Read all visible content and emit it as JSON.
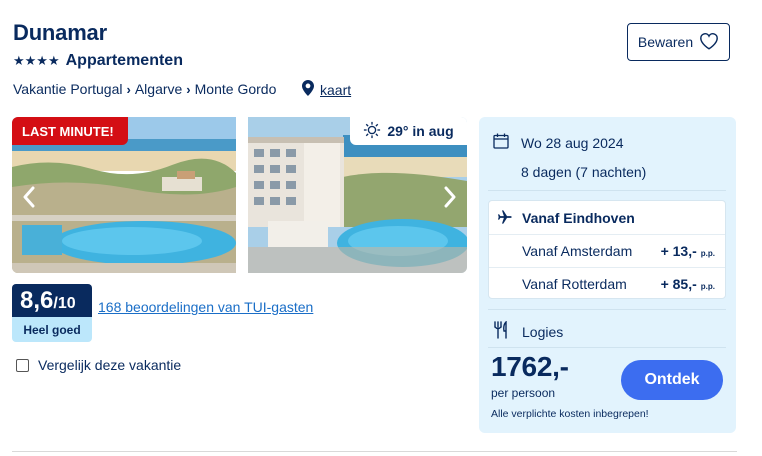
{
  "hotel": {
    "name": "Dunamar",
    "stars": "★★★★",
    "type": "Appartementen"
  },
  "breadcrumb": [
    "Vakantie Portugal",
    "Algarve",
    "Monte Gordo"
  ],
  "map_link": "kaart",
  "save_button": "Bewaren",
  "badge": "LAST MINUTE!",
  "weather": "29° in aug",
  "rating": {
    "score": "8,6",
    "max": "/10",
    "label": "Heel goed",
    "reviews": "168 beoordelingen van TUI-gasten"
  },
  "compare_label": "Vergelijk deze vakantie",
  "booking": {
    "date": "Wo 28 aug 2024",
    "duration": "8 dagen (7 nachten)",
    "departure_selected": "Vanaf Eindhoven",
    "alternatives": [
      {
        "name": "Vanaf Amsterdam",
        "price": "+ 13,-",
        "unit": "p.p."
      },
      {
        "name": "Vanaf Rotterdam",
        "price": "+ 85,-",
        "unit": "p.p."
      }
    ],
    "board": "Logies",
    "price": "1762,-",
    "per_person": "per persoon",
    "fine_print": "Alle verplichte kosten inbegrepen!",
    "cta": "Ontdek"
  },
  "colors": {
    "navy": "#092a5e",
    "badge_red": "#d40e14",
    "panel_bg": "#e2f3fd",
    "cta_blue": "#3c6df0",
    "score_label_bg": "#bce7fb",
    "link_blue": "#1a6ec7"
  }
}
